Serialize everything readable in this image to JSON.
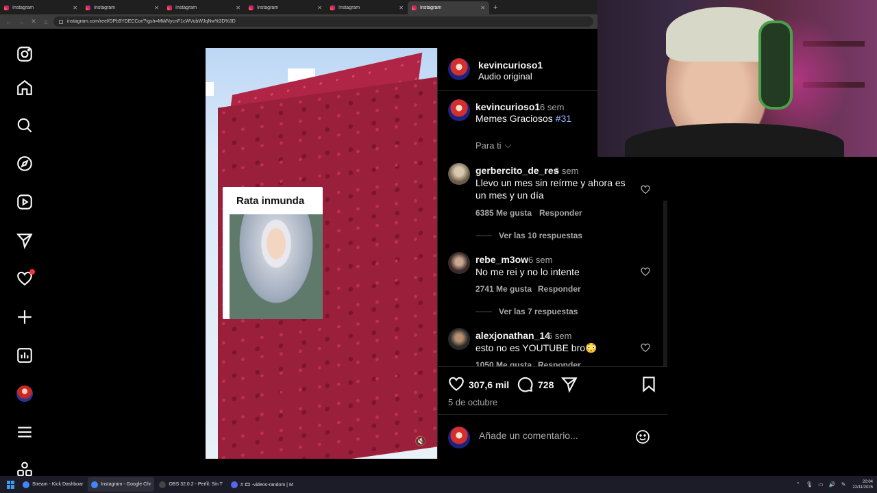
{
  "browser": {
    "tabs": [
      {
        "title": "Instagram",
        "active": false
      },
      {
        "title": "Instagram",
        "active": false
      },
      {
        "title": "Instagram",
        "active": false
      },
      {
        "title": "Instagram",
        "active": false
      },
      {
        "title": "Instagram",
        "active": false
      },
      {
        "title": "Instagram",
        "active": true
      }
    ],
    "url": "instagram.com/reel/DPb9YDECCor/?igsh=MWNycnF1cWVubWJqNw%3D%3D"
  },
  "video": {
    "meme_title": "Rata inmunda"
  },
  "post": {
    "author": "kevincurioso1",
    "audio": "Audio original",
    "caption_author": "kevincurioso1",
    "caption_time": "6 sem",
    "caption_text": "Memes Graciosos",
    "caption_hashtag": "#31",
    "translation": "Para ti"
  },
  "comments": [
    {
      "user": "gerbercito_de_res",
      "time": "6 sem",
      "text": "Llevo un mes sin reírme y ahora es un mes y un día",
      "likes": "6385 Me gusta",
      "reply": "Responder",
      "view_replies": "Ver las 10 respuestas"
    },
    {
      "user": "rebe_m3ow",
      "time": "6 sem",
      "text": "No me rei y no lo intente",
      "likes": "2741 Me gusta",
      "reply": "Responder",
      "view_replies": "Ver las 7 respuestas"
    },
    {
      "user": "alexjonathan_14",
      "time": "6 sem",
      "text": "esto no es YOUTUBE bro😳",
      "likes": "1050 Me gusta",
      "reply": "Responder"
    }
  ],
  "actions": {
    "likes": "307,6 mil",
    "comments": "728",
    "date": "5 de octubre"
  },
  "comment_box": {
    "placeholder": "Añade un comentario..."
  },
  "taskbar": {
    "items": [
      {
        "label": "Stream - Kick Dashboar",
        "color": "#4285f4"
      },
      {
        "label": "Instagram - Google Chr",
        "color": "#4285f4"
      },
      {
        "label": "OBS 32.0.2 - Perfil: Sin T",
        "color": "#444444"
      },
      {
        "label": "# 🎞 -videos-random | M",
        "color": "#5865f2"
      }
    ],
    "time": "20:04",
    "date": "22/11/2025"
  }
}
